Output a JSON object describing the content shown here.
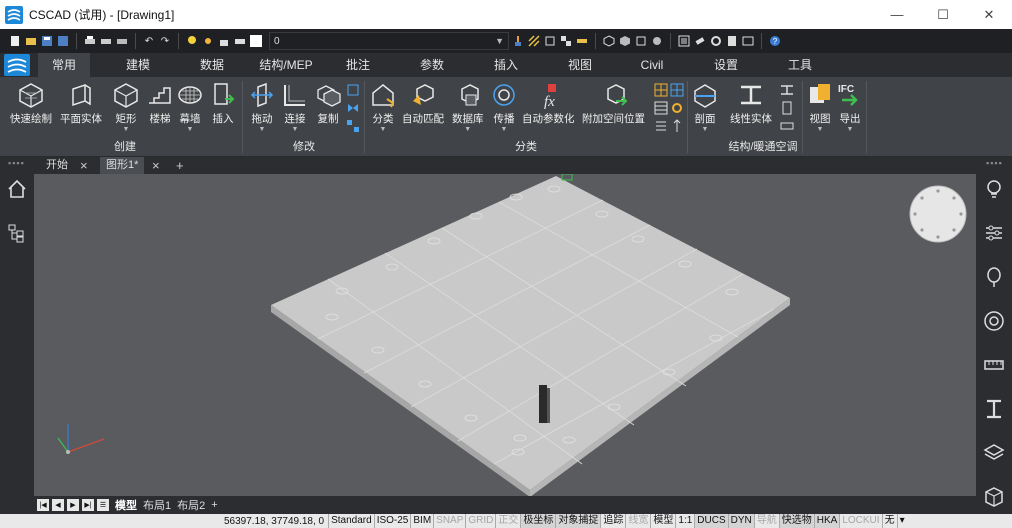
{
  "window": {
    "title": "CSCAD (试用) - [Drawing1]",
    "minimize": "—",
    "maximize": "☐",
    "close": "✕"
  },
  "quick_access": {
    "layer_value": "0"
  },
  "ribbon_tabs": [
    "常用",
    "建模",
    "数据",
    "结构/MEP",
    "批注",
    "参数",
    "插入",
    "视图",
    "Civil",
    "设置",
    "工具"
  ],
  "ribbon": {
    "buttons": [
      {
        "label": "快速绘制",
        "icon": "quick-draw-icon"
      },
      {
        "label": "平面实体",
        "icon": "plane-solid-icon"
      },
      {
        "label": "矩形",
        "icon": "rectangle-icon"
      },
      {
        "label": "楼梯",
        "icon": "stairs-icon"
      },
      {
        "label": "幕墙",
        "icon": "curtain-wall-icon"
      },
      {
        "label": "插入",
        "icon": "insert-icon"
      },
      {
        "label": "拖动",
        "icon": "drag-icon"
      },
      {
        "label": "连接",
        "icon": "connect-icon"
      },
      {
        "label": "复制",
        "icon": "copy-icon"
      },
      {
        "label": "分类",
        "icon": "classify-icon"
      },
      {
        "label": "自动匹配",
        "icon": "auto-match-icon"
      },
      {
        "label": "数据库",
        "icon": "database-icon"
      },
      {
        "label": "传播",
        "icon": "propagate-icon"
      },
      {
        "label": "自动参数化",
        "icon": "auto-parametric-icon"
      },
      {
        "label": "附加空间位置",
        "icon": "spatial-location-icon"
      },
      {
        "label": "剖面",
        "icon": "section-icon"
      },
      {
        "label": "线性实体",
        "icon": "linear-solid-icon"
      },
      {
        "label": "视图",
        "icon": "view-icon"
      },
      {
        "label": "导出",
        "icon": "export-ifc-icon"
      }
    ],
    "groups": [
      "创建",
      "修改",
      "分类",
      "结构/暖通空调"
    ]
  },
  "doc_tabs": {
    "start": "开始",
    "drawing": "图形1*",
    "new": "+"
  },
  "layout_tabs": {
    "model": "模型",
    "layout1": "布局1",
    "layout2": "布局2",
    "add": "+"
  },
  "status": {
    "coordinates": "56397.18, 37749.18, 0",
    "items": [
      "Standard",
      "ISO-25",
      "BIM",
      "SNAP",
      "GRID",
      "正交",
      "极坐标",
      "对象捕捉",
      "追踪",
      "线宽",
      "模型",
      "1:1",
      "DUCS",
      "DYN",
      "导航",
      "快选物",
      "HKA",
      "LOCKUI",
      "无"
    ],
    "off_items": [
      "SNAP",
      "GRID",
      "正交",
      "线宽",
      "导航",
      "LOCKUI"
    ]
  },
  "colors": {
    "ui_dark": "#2b2d30",
    "ribbon": "#404347",
    "viewport": "#595b5f",
    "slab_top": "#c9c9c9",
    "accent_blue": "#1e88d8"
  }
}
